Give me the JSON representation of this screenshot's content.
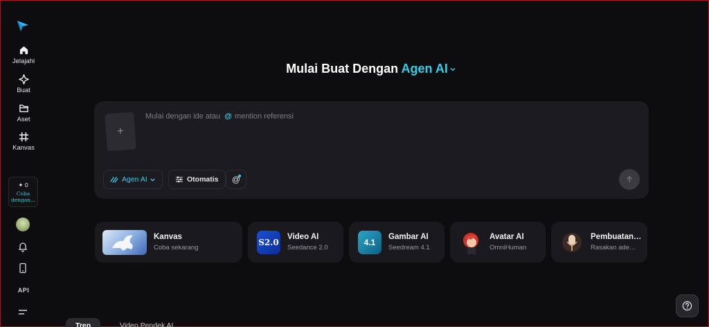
{
  "sidebar": {
    "items": [
      {
        "label": "Jelajahi",
        "icon": "home-icon"
      },
      {
        "label": "Buat",
        "icon": "sparkle-icon"
      },
      {
        "label": "Aset",
        "icon": "folder-icon"
      },
      {
        "label": "Kanvas",
        "icon": "canvas-grid-icon"
      }
    ],
    "promo": {
      "count": "0",
      "text": "Coba dengan..."
    },
    "api_label": "API"
  },
  "header": {
    "prefix": "Mulai Buat Dengan",
    "accent": "Agen AI"
  },
  "composer": {
    "placeholder_before": "Mulai dengan ide atau",
    "at_symbol": "@",
    "placeholder_after": "mention referensi",
    "upload_symbol": "+",
    "chips": {
      "agent": "Agen AI",
      "auto": "Otomatis",
      "mention": "@"
    }
  },
  "tools": [
    {
      "title": "Kanvas",
      "subtitle": "Coba sekarang"
    },
    {
      "title": "Video AI",
      "subtitle": "Seedance 2.0",
      "badge": "S2.0"
    },
    {
      "title": "Gambar AI",
      "subtitle": "Seedream 4.1",
      "badge": "4.1"
    },
    {
      "title": "Avatar AI",
      "subtitle": "OmniHuman"
    },
    {
      "title": "Pembuatan…",
      "subtitle": "Rasakan ade…"
    }
  ],
  "tabs": [
    "Tren",
    "Video Pendek AI"
  ],
  "colors": {
    "accent": "#2fd0e8",
    "background": "#0d0d0f",
    "card": "#1a1a1e"
  }
}
